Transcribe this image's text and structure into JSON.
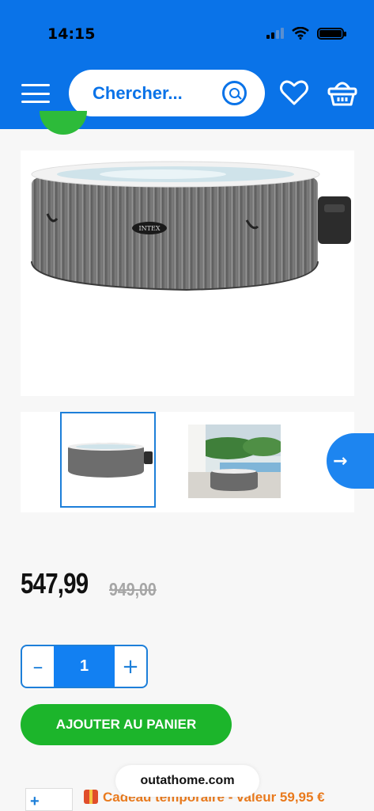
{
  "status_bar": {
    "time": "14:15"
  },
  "header": {
    "search": {
      "placeholder": "Chercher..."
    },
    "icons": [
      "menu-icon",
      "search-icon",
      "heart-icon",
      "basket-icon"
    ]
  },
  "product": {
    "price": "547,99",
    "old_price": "949,00",
    "quantity": "1",
    "qty_minus": "–",
    "qty_plus": "+",
    "add_to_cart_label": "AJOUTER AU PANIER",
    "brand_logo_text": "INTEX"
  },
  "gallery": {
    "next_arrow": "→"
  },
  "promo": {
    "gift_text": "Cadeau temporaire - valeur 59,95 €",
    "plus": "+"
  },
  "browser": {
    "url": "outathome.com"
  },
  "colors": {
    "header_blue": "#0a73e8",
    "cart_green": "#1cb52b",
    "gift_orange": "#e97a1d"
  }
}
